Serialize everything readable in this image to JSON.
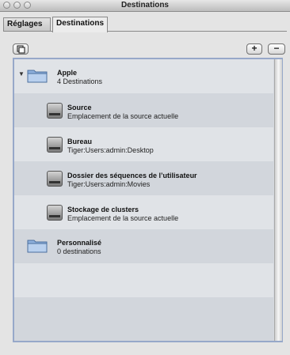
{
  "window": {
    "title": "Destinations"
  },
  "tabs": [
    {
      "label": "Réglages",
      "active": false
    },
    {
      "label": "Destinations",
      "active": true
    }
  ],
  "toolbar": {
    "duplicate_icon": "duplicate-icon",
    "add_label": "+",
    "remove_label": "−"
  },
  "groups": [
    {
      "name": "Apple",
      "count_label": "4 Destinations",
      "expanded": true,
      "items": [
        {
          "name": "Source",
          "location": "Emplacement de la source actuelle"
        },
        {
          "name": "Bureau",
          "location": "Tiger:Users:admin:Desktop"
        },
        {
          "name": "Dossier des séquences de l’utilisateur",
          "location": "Tiger:Users:admin:Movies"
        },
        {
          "name": "Stockage de clusters",
          "location": "Emplacement de la source actuelle"
        }
      ]
    },
    {
      "name": "Personnalisé",
      "count_label": "0 destinations",
      "expanded": false,
      "items": []
    }
  ],
  "colors": {
    "list_border": "#97a8c9",
    "folder": "#8fb0dc",
    "row_alt": "#e0e3e7"
  }
}
